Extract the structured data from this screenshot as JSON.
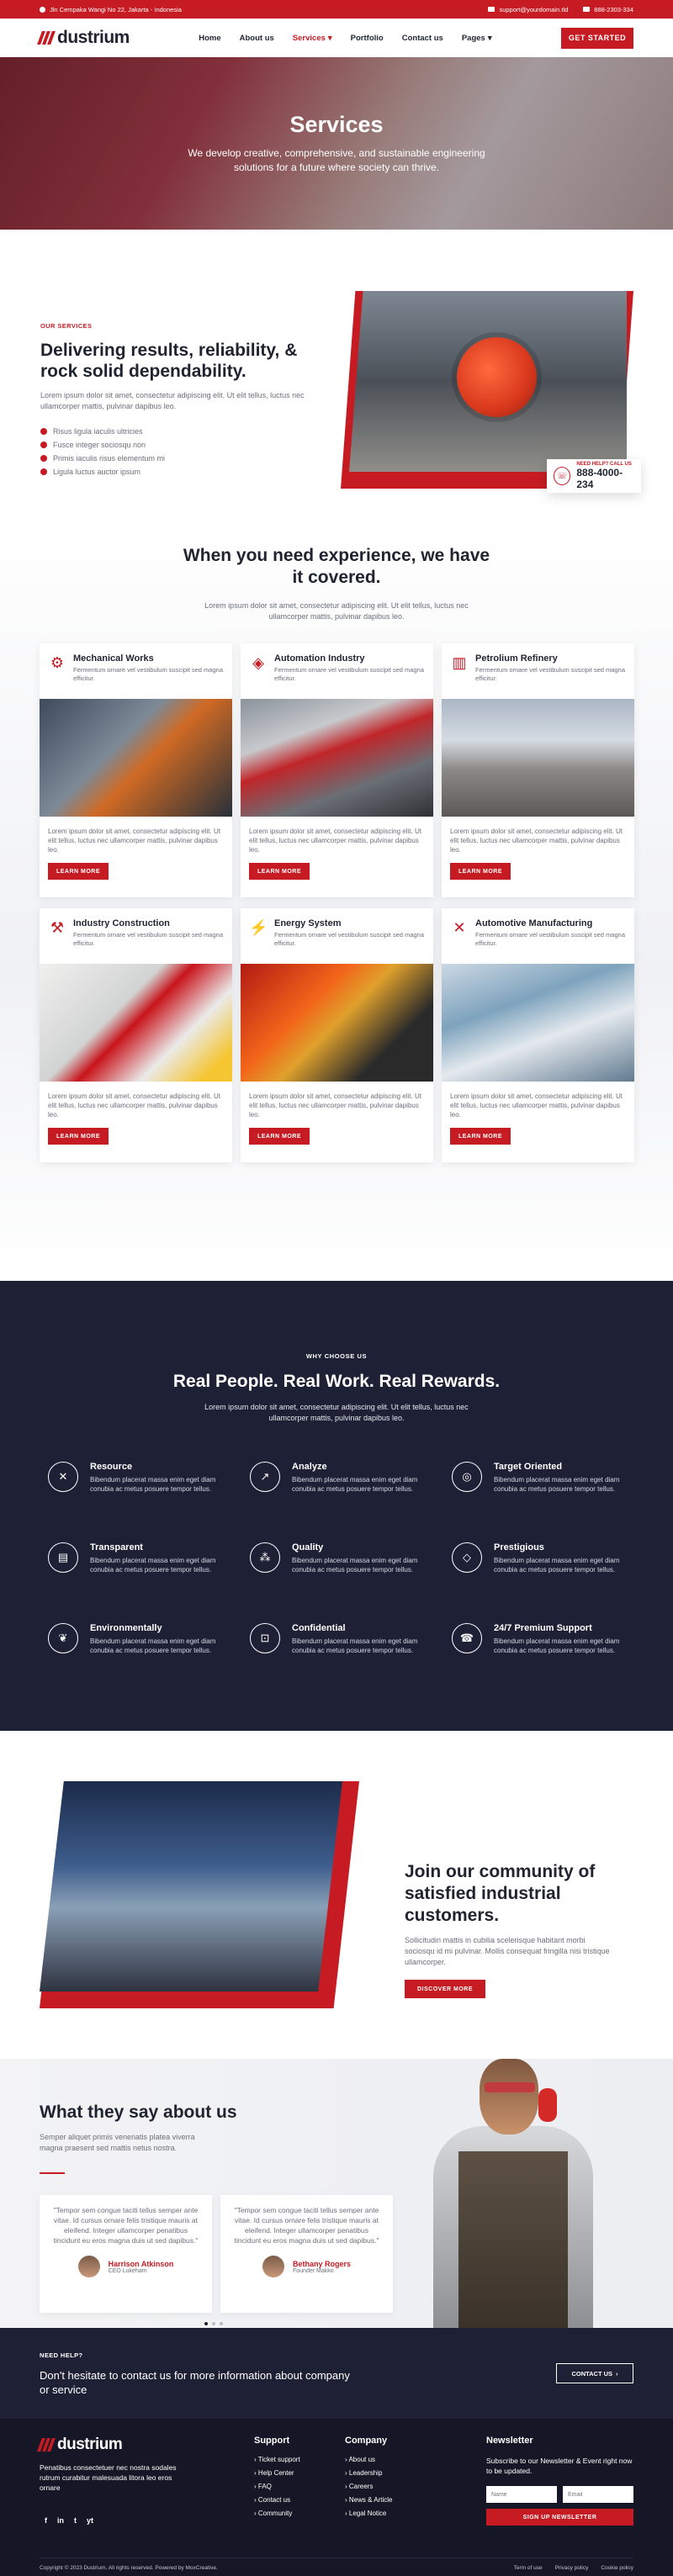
{
  "topbar": {
    "address": "Jln Cempaka Wangi No 22, Jakarta - Indonesia",
    "email": "support@yourdomain.tld",
    "phone": "888-2303-334"
  },
  "header": {
    "logo_text": "dustrium",
    "nav": [
      {
        "label": "Home"
      },
      {
        "label": "About us"
      },
      {
        "label": "Services"
      },
      {
        "label": "Portfolio"
      },
      {
        "label": "Contact us"
      },
      {
        "label": "Pages"
      }
    ],
    "cta": "GET STARTED"
  },
  "hero": {
    "title": "Services",
    "subtitle": "We develop creative, comprehensive, and sustainable engineering solutions for a future where society can thrive."
  },
  "intro": {
    "eyebrow": "OUR SERVICES",
    "title": "Delivering results, reliability, & rock solid dependability.",
    "text": "Lorem ipsum dolor sit amet, consectetur adipiscing elit. Ut elit tellus, luctus nec ullamcorper mattis, pulvinar dapibus leo.",
    "checklist": [
      "Risus ligula iaculis ultricies",
      "Fusce integer sociosqu non",
      "Primis iaculis risus elementum mi",
      "Ligula luctus auctor ipsum"
    ],
    "help_label": "NEED HELP? CALL US",
    "help_phone": "888-4000-234"
  },
  "services": {
    "title": "When you need experience, we have it covered.",
    "subtitle": "Lorem ipsum dolor sit amet, consectetur adipiscing elit. Ut elit tellus, luctus nec ullamcorper mattis, pulvinar dapibus leo.",
    "cards": [
      {
        "title": "Mechanical Works",
        "desc": "Fermentum ornare vel vestibulum suscipit sed magna efficitur.",
        "body": "Lorem ipsum dolor sit amet, consectetur adipiscing elit. Ut elit tellus, luctus nec ullamcorper mattis, pulvinar dapibus leo.",
        "btn": "LEARN MORE",
        "icon": "gear-icon"
      },
      {
        "title": "Automation Industry",
        "desc": "Fermentum ornare vel vestibulum suscipit sed magna efficitur.",
        "body": "Lorem ipsum dolor sit amet, consectetur adipiscing elit. Ut elit tellus, luctus nec ullamcorper mattis, pulvinar dapibus leo.",
        "btn": "LEARN MORE",
        "icon": "layers-icon"
      },
      {
        "title": "Petrolium Refinery",
        "desc": "Fermentum ornare vel vestibulum suscipit sed magna efficitur.",
        "body": "Lorem ipsum dolor sit amet, consectetur adipiscing elit. Ut elit tellus, luctus nec ullamcorper mattis, pulvinar dapibus leo.",
        "btn": "LEARN MORE",
        "icon": "factory-icon"
      },
      {
        "title": "Industry Construction",
        "desc": "Fermentum ornare vel vestibulum suscipit sed magna efficitur.",
        "body": "Lorem ipsum dolor sit amet, consectetur adipiscing elit. Ut elit tellus, luctus nec ullamcorper mattis, pulvinar dapibus leo.",
        "btn": "LEARN MORE",
        "icon": "crane-icon"
      },
      {
        "title": "Energy System",
        "desc": "Fermentum ornare vel vestibulum suscipit sed magna efficitur.",
        "body": "Lorem ipsum dolor sit amet, consectetur adipiscing elit. Ut elit tellus, luctus nec ullamcorper mattis, pulvinar dapibus leo.",
        "btn": "LEARN MORE",
        "icon": "bolt-icon"
      },
      {
        "title": "Automotive Manufacturing",
        "desc": "Fermentum ornare vel vestibulum suscipit sed magna efficitur.",
        "body": "Lorem ipsum dolor sit amet, consectetur adipiscing elit. Ut elit tellus, luctus nec ullamcorper mattis, pulvinar dapibus leo.",
        "btn": "LEARN MORE",
        "icon": "tools-icon"
      }
    ]
  },
  "why": {
    "eyebrow": "WHY CHOOSE US",
    "title": "Real People. Real Work. Real Rewards.",
    "subtitle": "Lorem ipsum dolor sit amet, consectetur adipiscing elit. Ut elit tellus, luctus nec ullamcorper mattis, pulvinar dapibus leo.",
    "features": [
      {
        "title": "Resource",
        "text": "Bibendum placerat massa enim eget diam conubia ac metus posuere tempor tellus.",
        "icon": "tools-icon"
      },
      {
        "title": "Analyze",
        "text": "Bibendum placerat massa enim eget diam conubia ac metus posuere tempor tellus.",
        "icon": "chart-icon"
      },
      {
        "title": "Target Oriented",
        "text": "Bibendum placerat massa enim eget diam conubia ac metus posuere tempor tellus.",
        "icon": "target-icon"
      },
      {
        "title": "Transparent",
        "text": "Bibendum placerat massa enim eget diam conubia ac metus posuere tempor tellus.",
        "icon": "document-icon"
      },
      {
        "title": "Quality",
        "text": "Bibendum placerat massa enim eget diam conubia ac metus posuere tempor tellus.",
        "icon": "network-icon"
      },
      {
        "title": "Prestigious",
        "text": "Bibendum placerat massa enim eget diam conubia ac metus posuere tempor tellus.",
        "icon": "diamond-icon"
      },
      {
        "title": "Environmentally",
        "text": "Bibendum placerat massa enim eget diam conubia ac metus posuere tempor tellus.",
        "icon": "leaf-icon"
      },
      {
        "title": "Confidential",
        "text": "Bibendum placerat massa enim eget diam conubia ac metus posuere tempor tellus.",
        "icon": "lock-icon"
      },
      {
        "title": "24/7 Premium Support",
        "text": "Bibendum placerat massa enim eget diam conubia ac metus posuere tempor tellus.",
        "icon": "support-icon"
      }
    ]
  },
  "community": {
    "title": "Join our community of satisfied industrial customers.",
    "text": "Sollicitudin mattis in cubilia scelerisque habitant morbi sociosqu id mi pulvinar. Mollis consequat fringilla nisi tristique ullamcorper.",
    "btn": "DISCOVER MORE"
  },
  "testimonials": {
    "title": "What they say about us",
    "subtitle": "Semper aliquet primis venenatis platea viverra magna praesent sed mattis netus nostra.",
    "items": [
      {
        "quote": "\"Tempor sem congue taciti tellus semper ante vitae. Id cursus ornare felis tristique mauris at eleifend. Integer ullamcorper penatibus tincidunt eu eros magna duis ut sed dapibus.\"",
        "name": "Harrison Atkinson",
        "role": "CEO Lukeham"
      },
      {
        "quote": "\"Tempor sem congue taciti tellus semper ante vitae. Id cursus ornare felis tristique mauris at eleifend. Integer ullamcorper penatibus tincidunt eu eros magna duis ut sed dapibus.\"",
        "name": "Bethany Rogers",
        "role": "Founder Makko"
      }
    ]
  },
  "help": {
    "eyebrow": "NEED HELP?",
    "text": "Don't hesitate to contact us for more information about company or service",
    "btn": "CONTACT US"
  },
  "footer": {
    "logo_text": "dustrium",
    "about": "Penatibus consectetuer nec nostra sodales rutrum curabitur malesuada litora leo eros ornare",
    "socials": [
      "f",
      "in",
      "t",
      "yt"
    ],
    "support": {
      "title": "Support",
      "items": [
        "Ticket support",
        "Help Center",
        "FAQ",
        "Contact us",
        "Community"
      ]
    },
    "company": {
      "title": "Company",
      "items": [
        "About us",
        "Leadership",
        "Careers",
        "News & Article",
        "Legal Notice"
      ]
    },
    "newsletter": {
      "title": "Newsletter",
      "text": "Subscribe to our Newsletter & Event right now to be updated.",
      "name_placeholder": "Name",
      "email_placeholder": "Email",
      "btn": "SIGN UP NEWSLETTER"
    },
    "copyright": "Copyright © 2023 Dustrium, All rights reserved. Powered by MoxCreative.",
    "legal": [
      "Term of use",
      "Privacy policy",
      "Cookie policy"
    ]
  },
  "colors": {
    "accent": "#c61b23",
    "dark": "#1e2035"
  }
}
